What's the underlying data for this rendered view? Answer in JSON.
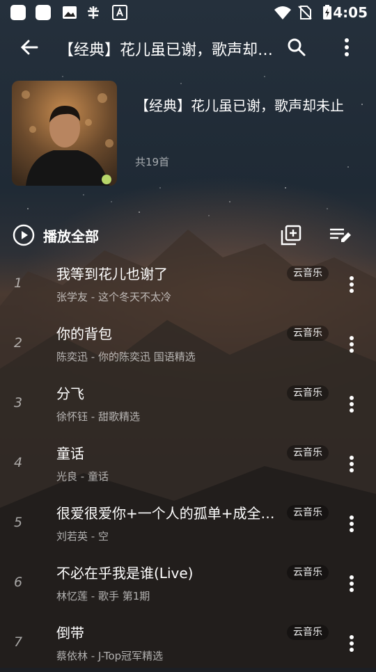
{
  "status_bar": {
    "time": "4:05",
    "left_icons": [
      "app-icon-square",
      "app-icon-square",
      "image-icon",
      "bug-icon",
      "font-icon"
    ],
    "right_icons": [
      "wifi-icon",
      "no-sim-icon",
      "battery-charging-icon"
    ]
  },
  "toolbar": {
    "title": "【经典】花儿虽已谢，歌声却未止",
    "back_icon": "arrow-left-icon",
    "search_icon": "search-icon",
    "more_icon": "more-vertical-icon"
  },
  "playlist": {
    "title": "【经典】花儿虽已谢，歌声却未止",
    "count_label": "共19首"
  },
  "actions": {
    "play_all_label": "播放全部",
    "add_icon": "add-to-library-icon",
    "edit_icon": "playlist-edit-icon"
  },
  "songs": [
    {
      "index": "1",
      "title": "我等到花儿也谢了",
      "subtitle": "张学友 - 这个冬天不太冷",
      "badge": "云音乐"
    },
    {
      "index": "2",
      "title": "你的背包",
      "subtitle": "陈奕迅 - 你的陈奕迅 国语精选",
      "badge": "云音乐"
    },
    {
      "index": "3",
      "title": "分飞",
      "subtitle": "徐怀钰 - 甜歌精选",
      "badge": "云音乐"
    },
    {
      "index": "4",
      "title": "童话",
      "subtitle": "光良 - 童话",
      "badge": "云音乐"
    },
    {
      "index": "5",
      "title": "很爱很爱你+一个人的孤单+成全+浪...",
      "subtitle": "刘若英 - 空",
      "badge": "云音乐"
    },
    {
      "index": "6",
      "title": "不必在乎我是谁(Live)",
      "subtitle": "林忆莲 - 歌手 第1期",
      "badge": "云音乐"
    },
    {
      "index": "7",
      "title": "倒带",
      "subtitle": "蔡依林 - J-Top冠军精选",
      "badge": "云音乐"
    }
  ]
}
